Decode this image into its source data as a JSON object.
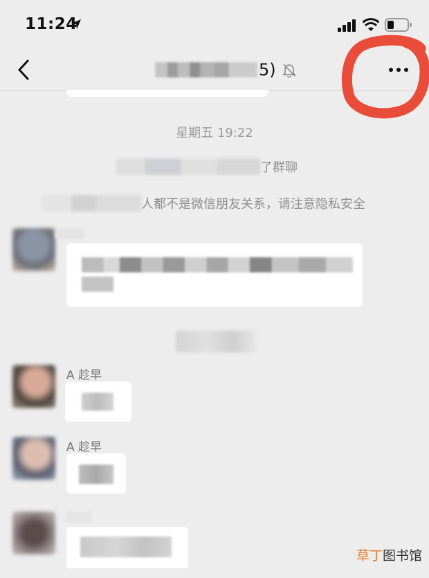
{
  "status_bar": {
    "time": "11:24",
    "icons": [
      "location-arrow-icon",
      "signal-icon",
      "wifi-icon",
      "battery-icon"
    ]
  },
  "nav": {
    "title_suffix": "5)",
    "icons": [
      "back-chevron-icon",
      "mute-bell-icon",
      "more-dots-icon"
    ]
  },
  "chat": {
    "timestamp": "星期五 19:22",
    "system_join_text": "了群聊",
    "system_warning_text": "人都不是微信朋友关系，请注意隐私安全",
    "messages": [
      {
        "sender": "",
        "text": ""
      },
      {
        "sender": "A  趁早",
        "text": ""
      },
      {
        "sender": "A  趁早",
        "text": ""
      },
      {
        "sender": "",
        "text": ""
      }
    ]
  },
  "watermark": {
    "accent": "草丁",
    "rest": "图书馆"
  },
  "colors": {
    "background": "#ededed",
    "annotation": "#e8412c",
    "bubble": "#ffffff"
  }
}
